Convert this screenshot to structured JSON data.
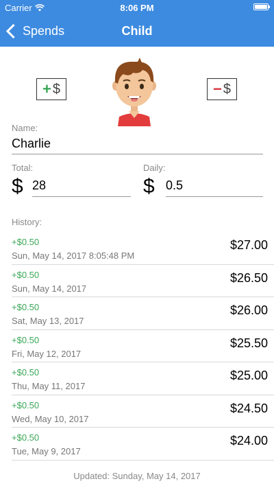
{
  "status_bar": {
    "carrier": "Carrier",
    "time": "8:06 PM"
  },
  "nav": {
    "back_label": "Spends",
    "title": "Child"
  },
  "actions": {
    "add_icon": "plus-money-icon",
    "subtract_icon": "minus-money-icon",
    "add_sign": "+",
    "subtract_sign": "−",
    "currency": "$"
  },
  "avatar": {
    "icon": "boy-avatar-icon"
  },
  "name": {
    "label": "Name:",
    "value": "Charlie"
  },
  "total": {
    "label": "Total:",
    "currency": "$",
    "value": "28"
  },
  "daily": {
    "label": "Daily:",
    "currency": "$",
    "value": "0.5"
  },
  "history": {
    "label": "History:",
    "items": [
      {
        "amount": "+$0.50",
        "date": "Sun, May 14, 2017 8:05:48 PM",
        "balance": "$27.00"
      },
      {
        "amount": "+$0.50",
        "date": "Sun, May 14, 2017",
        "balance": "$26.50"
      },
      {
        "amount": "+$0.50",
        "date": "Sat, May 13, 2017",
        "balance": "$26.00"
      },
      {
        "amount": "+$0.50",
        "date": "Fri, May 12, 2017",
        "balance": "$25.50"
      },
      {
        "amount": "+$0.50",
        "date": "Thu, May 11, 2017",
        "balance": "$25.00"
      },
      {
        "amount": "+$0.50",
        "date": "Wed, May 10, 2017",
        "balance": "$24.50"
      },
      {
        "amount": "+$0.50",
        "date": "Tue, May 9, 2017",
        "balance": "$24.00"
      }
    ]
  },
  "footer": {
    "updated": "Updated: Sunday, May 14, 2017"
  },
  "colors": {
    "nav_bg": "#3d8be0",
    "positive": "#3aa757",
    "negative": "#d8353c"
  }
}
